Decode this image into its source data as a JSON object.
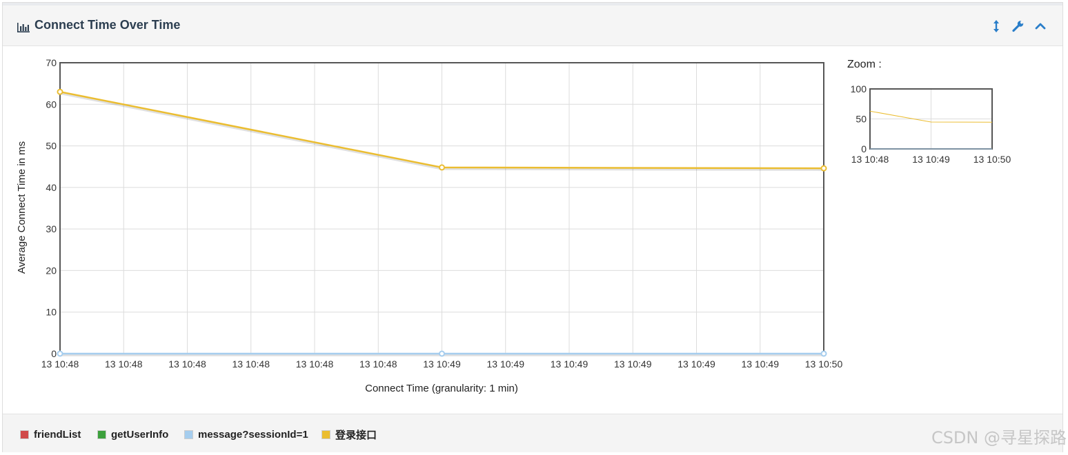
{
  "panel": {
    "title": "Connect Time Over Time",
    "tools": [
      {
        "icon": "resize-vertical-icon"
      },
      {
        "icon": "wrench-icon"
      },
      {
        "icon": "chevron-up-icon"
      }
    ]
  },
  "colors": {
    "friendList": "#d04a4a",
    "getUserInfo": "#3ca03c",
    "message": "#a5cdee",
    "login": "#ebbd30",
    "header_text": "#2c3e50",
    "icon_blue": "#2a7ec9"
  },
  "chart_data": [
    {
      "type": "line",
      "title": "",
      "xlabel": "Connect Time (granularity: 1 min)",
      "ylabel": "Average Connect Time in ms",
      "ylim": [
        0,
        70
      ],
      "yticks": [
        0,
        10,
        20,
        30,
        40,
        50,
        60,
        70
      ],
      "xtick_labels": [
        "13 10:48",
        "13 10:48",
        "13 10:48",
        "13 10:48",
        "13 10:48",
        "13 10:48",
        "13 10:49",
        "13 10:49",
        "13 10:49",
        "13 10:49",
        "13 10:49",
        "13 10:49",
        "13 10:50"
      ],
      "x": [
        "13 10:48",
        "13 10:49",
        "13 10:50"
      ],
      "grid": true,
      "series": [
        {
          "name": "message?sessionId=1",
          "values": [
            0,
            0,
            0
          ]
        },
        {
          "name": "登录接口",
          "values": [
            63,
            44.8,
            44.6
          ]
        }
      ]
    },
    {
      "type": "line",
      "title": "Zoom :",
      "ylim": [
        0,
        100
      ],
      "yticks": [
        0,
        50,
        100
      ],
      "xtick_labels": [
        "13 10:48",
        "13 10:49",
        "13 10:50"
      ],
      "x": [
        "13 10:48",
        "13 10:49",
        "13 10:50"
      ],
      "grid": true,
      "series": [
        {
          "name": "message?sessionId=1",
          "values": [
            0,
            0,
            0
          ]
        },
        {
          "name": "登录接口",
          "values": [
            63,
            44.8,
            44.6
          ]
        }
      ]
    }
  ],
  "legend": [
    {
      "label": "friendList",
      "color": "#d04a4a"
    },
    {
      "label": "getUserInfo",
      "color": "#3ca03c"
    },
    {
      "label": "message?sessionId=1",
      "color": "#a5cdee"
    },
    {
      "label": "登录接口",
      "color": "#ebbd30"
    }
  ],
  "watermark": "CSDN @寻星探路"
}
